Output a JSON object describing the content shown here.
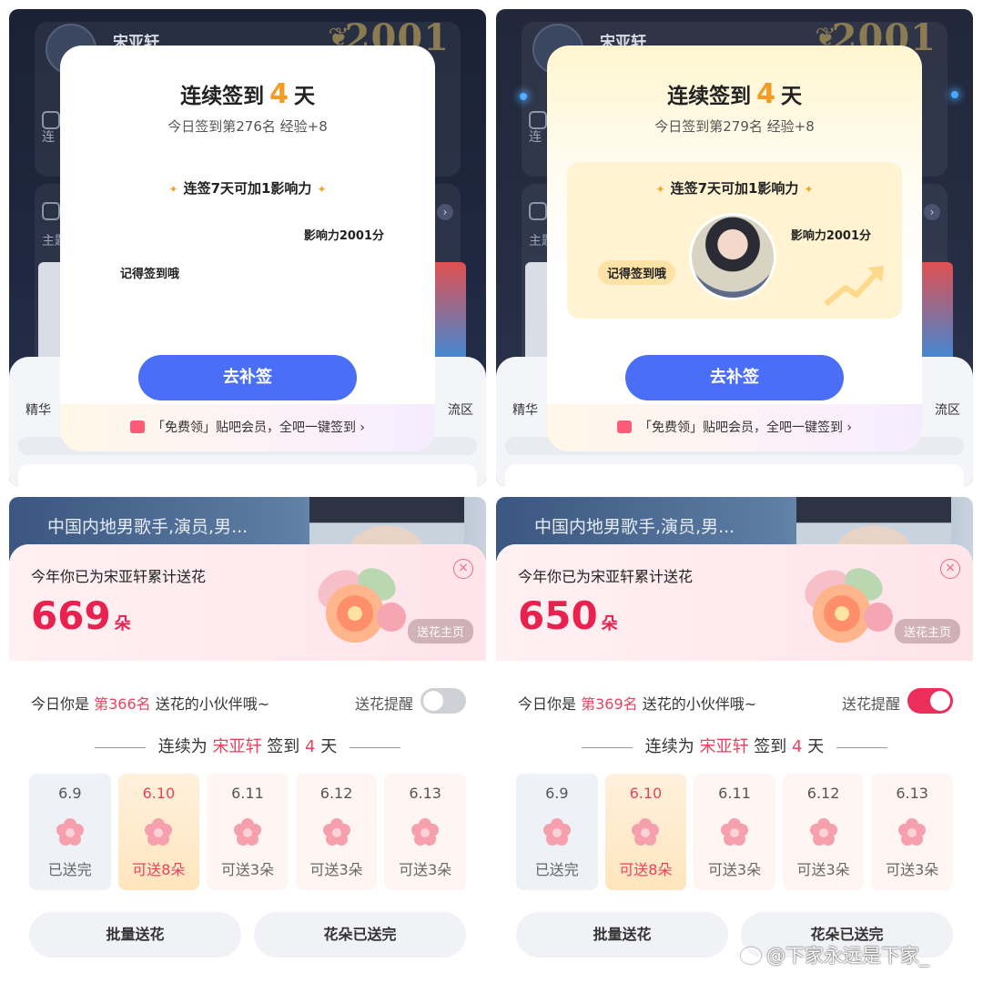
{
  "colors": {
    "accent_blue": "#4a6ef5",
    "accent_pink": "#e8214f",
    "accent_orange": "#f59a23"
  },
  "background": {
    "user_name": "宋亚轩",
    "badge_number": "2001",
    "tab_left": "精华",
    "tab_right_partial": "流区",
    "row1_partial": "连",
    "row2_partial": "主题"
  },
  "popups": [
    {
      "title_prefix": "连续签到",
      "days": "4",
      "title_suffix": "天",
      "subtitle": "今日签到第276名 经验+8",
      "box_title": "连签7天可加1影响力",
      "influence": "影响力2001分",
      "remind": "记得签到哦",
      "button": "去补签",
      "footer": "「免费领」贴吧会员，全吧一键签到 ›"
    },
    {
      "title_prefix": "连续签到",
      "days": "4",
      "title_suffix": "天",
      "subtitle": "今日签到第279名 经验+8",
      "box_title": "连签7天可加1影响力",
      "influence": "影响力2001分",
      "remind": "记得签到哦",
      "button": "去补签",
      "footer": "「免费领」贴吧会员，全吧一键签到 ›"
    }
  ],
  "flowers": [
    {
      "banner_text": "中国内地男歌手,演员,男...",
      "label": "今年你已为宋亚轩累计送花",
      "count": "669",
      "unit": "朵",
      "home_button": "送花主页",
      "rank_prefix": "今日你是",
      "rank": "第366名",
      "rank_suffix": "送花的小伙伴哦~",
      "remind_label": "送花提醒",
      "remind_on": false,
      "streak_prefix": "连续为",
      "streak_name": "宋亚轩",
      "streak_mid": "签到",
      "streak_days": "4",
      "streak_suffix": "天",
      "days": [
        {
          "date": "6.9",
          "status": "已送完"
        },
        {
          "date": "6.10",
          "status": "可送8朵"
        },
        {
          "date": "6.11",
          "status": "可送3朵"
        },
        {
          "date": "6.12",
          "status": "可送3朵"
        },
        {
          "date": "6.13",
          "status": "可送3朵"
        }
      ],
      "btn_batch": "批量送花",
      "btn_done": "花朵已送完"
    },
    {
      "banner_text": "中国内地男歌手,演员,男...",
      "label": "今年你已为宋亚轩累计送花",
      "count": "650",
      "unit": "朵",
      "home_button": "送花主页",
      "rank_prefix": "今日你是",
      "rank": "第369名",
      "rank_suffix": "送花的小伙伴哦~",
      "remind_label": "送花提醒",
      "remind_on": true,
      "streak_prefix": "连续为",
      "streak_name": "宋亚轩",
      "streak_mid": "签到",
      "streak_days": "4",
      "streak_suffix": "天",
      "days": [
        {
          "date": "6.9",
          "status": "已送完"
        },
        {
          "date": "6.10",
          "status": "可送8朵"
        },
        {
          "date": "6.11",
          "status": "可送3朵"
        },
        {
          "date": "6.12",
          "status": "可送3朵"
        },
        {
          "date": "6.13",
          "status": "可送3朵"
        }
      ],
      "btn_batch": "批量送花",
      "btn_done": "花朵已送完"
    }
  ],
  "watermark": "@下家永远是下家_"
}
